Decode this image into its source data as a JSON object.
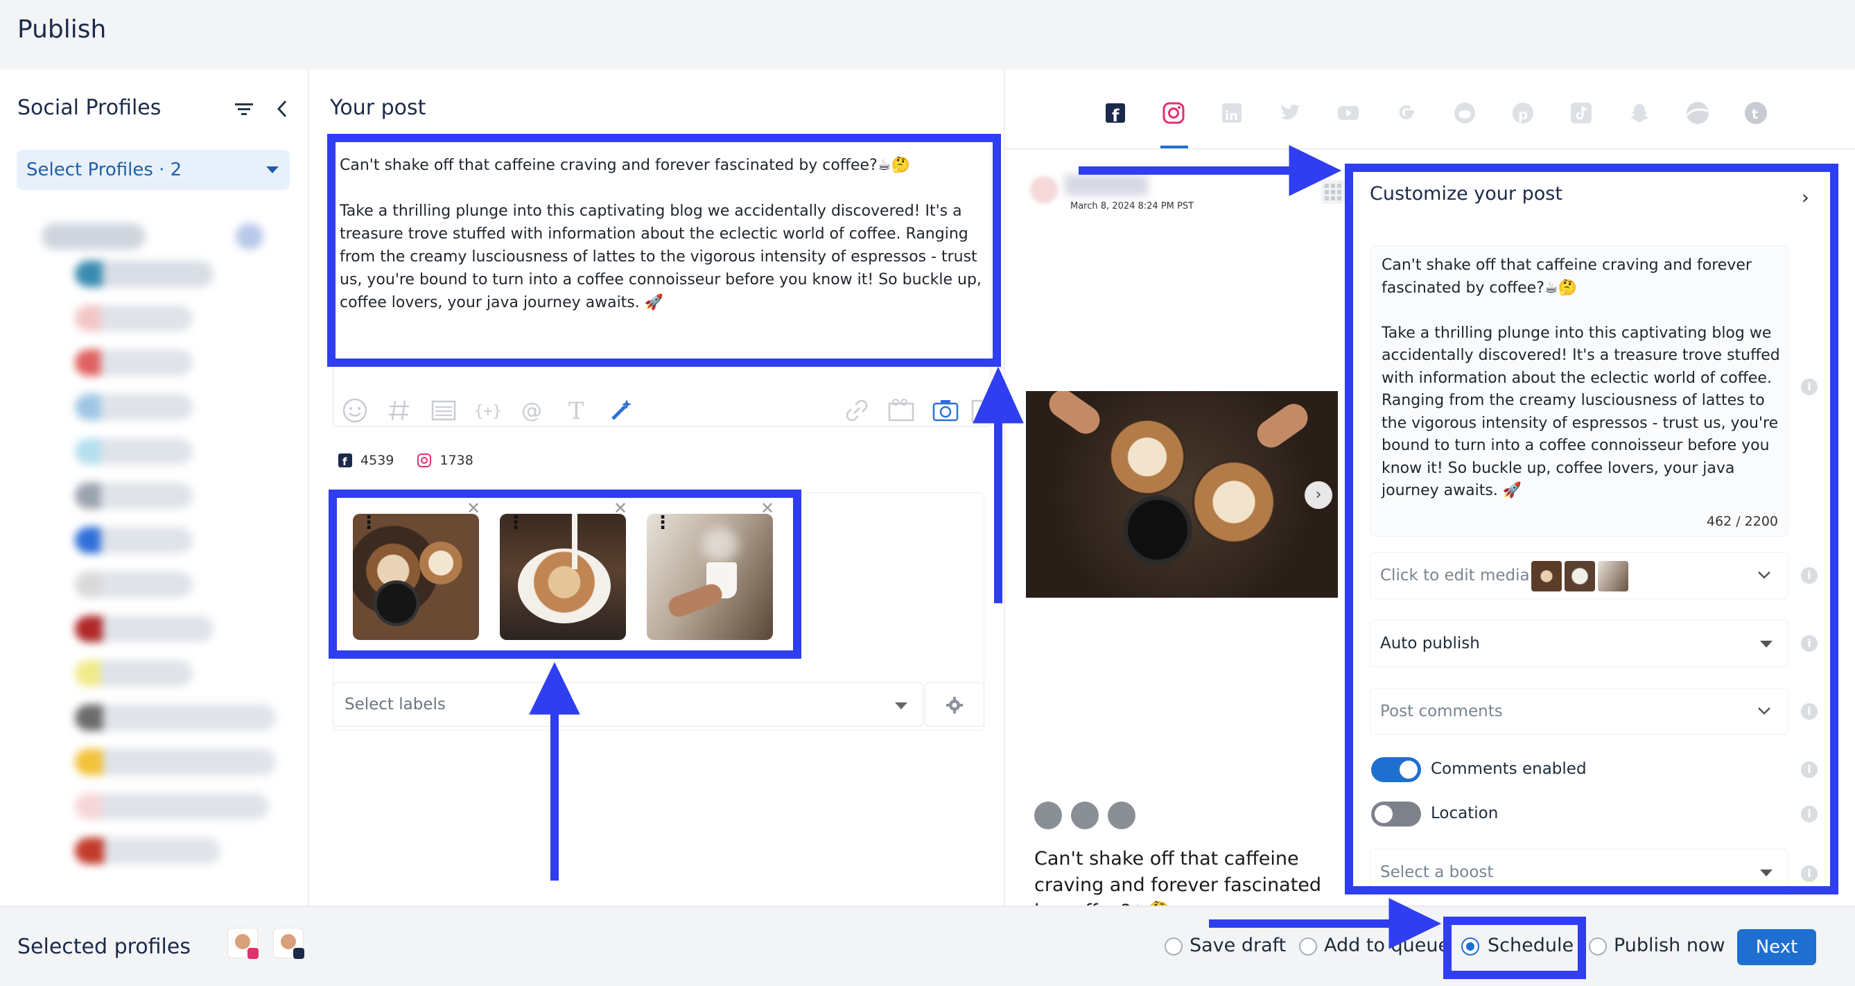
{
  "header": {
    "title": "Publish"
  },
  "sidebar": {
    "title": "Social Profiles",
    "select_profiles_label": "Select Profiles · 2",
    "icons": {
      "filter": "filter-icon",
      "collapse": "chevron-left-icon"
    }
  },
  "composer": {
    "title": "Your post",
    "post_text": "Can't shake off that caffeine craving and forever fascinated by coffee?☕🤔\n\nTake a thrilling plunge into this captivating blog we accidentally discovered! It's a treasure trove stuffed with information about the eclectic world of coffee. Ranging from the creamy lusciousness of lattes to the vigorous intensity of espressos - trust us, you're bound to turn into a coffee connoisseur before you know it! So buckle up, coffee lovers, your java journey awaits. 🚀",
    "toolbar": [
      "emoji-icon",
      "hashtag-icon",
      "template-icon",
      "variable-icon",
      "mention-icon",
      "text-format-icon",
      "ai-magic-icon",
      "link-icon",
      "gif-icon",
      "camera-icon",
      "document-icon"
    ],
    "counts": {
      "facebook": "4539",
      "instagram": "1738"
    },
    "labels_placeholder": "Select labels"
  },
  "preview": {
    "networks": [
      "facebook",
      "instagram",
      "linkedin",
      "twitter",
      "youtube",
      "google",
      "reddit",
      "pinterest",
      "tiktok",
      "snapchat",
      "threads",
      "tumblr"
    ],
    "active_network": "instagram",
    "date": "March 8, 2024 8:24 PM PST",
    "caption": "Can't shake off that caffeine craving and forever fascinated by coffee?☕🤔\n\nTake a thrilling plunge into this"
  },
  "customize": {
    "title": "Customize your post",
    "text": "Can't shake off that caffeine craving and forever fascinated by coffee?☕🤔\n\nTake a thrilling plunge into this captivating blog we accidentally discovered! It's a treasure trove stuffed with information about the eclectic world of coffee. Ranging from the creamy lusciousness of lattes to the vigorous intensity of espressos - trust us, you're bound to turn into a coffee connoisseur before you know it! So buckle up, coffee lovers, your java journey awaits. 🚀",
    "counter": "462 / 2200",
    "media_placeholder": "Click to edit media",
    "publish_mode": "Auto publish",
    "post_comments_placeholder": "Post comments",
    "comments_enabled_label": "Comments enabled",
    "comments_enabled": true,
    "location_label": "Location",
    "location_enabled": false,
    "boost_placeholder": "Select a boost"
  },
  "footer": {
    "selected_profiles_label": "Selected profiles",
    "options": [
      {
        "label": "Save draft",
        "selected": false
      },
      {
        "label": "Add to queue",
        "selected": false
      },
      {
        "label": "Schedule",
        "selected": true
      },
      {
        "label": "Publish now",
        "selected": false
      }
    ],
    "next_label": "Next"
  },
  "colors": {
    "accent": "#1f6fd0",
    "highlight": "#2f3ef0",
    "instagram": "#e1306c",
    "facebook": "#1877f2"
  }
}
